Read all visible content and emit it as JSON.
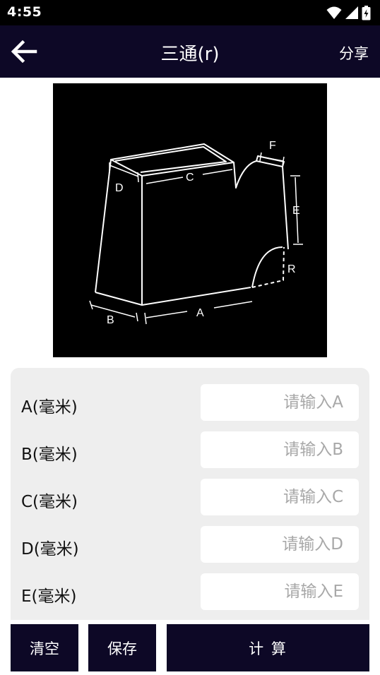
{
  "status_bar": {
    "time": "4:55"
  },
  "app_bar": {
    "title": "三通(r)",
    "share_label": "分享"
  },
  "diagram": {
    "labels": {
      "a": "A",
      "b": "B",
      "c": "C",
      "d": "D",
      "e": "E",
      "f": "F",
      "r": "R"
    }
  },
  "form": {
    "rows": [
      {
        "label": "A(毫米)",
        "placeholder": "请输入A",
        "value": ""
      },
      {
        "label": "B(毫米)",
        "placeholder": "请输入B",
        "value": ""
      },
      {
        "label": "C(毫米)",
        "placeholder": "请输入C",
        "value": ""
      },
      {
        "label": "D(毫米)",
        "placeholder": "请输入D",
        "value": ""
      },
      {
        "label": "E(毫米)",
        "placeholder": "请输入E",
        "value": ""
      }
    ]
  },
  "actions": {
    "clear_label": "清空",
    "save_label": "保存",
    "calculate_label": "计 算"
  },
  "colors": {
    "app_bar": "#0d0826",
    "status_bar": "#000000",
    "card": "#eeeeee",
    "placeholder": "#a8a8a8"
  },
  "icons": [
    "back-arrow-icon",
    "wifi-icon",
    "signal-icon",
    "battery-icon"
  ]
}
